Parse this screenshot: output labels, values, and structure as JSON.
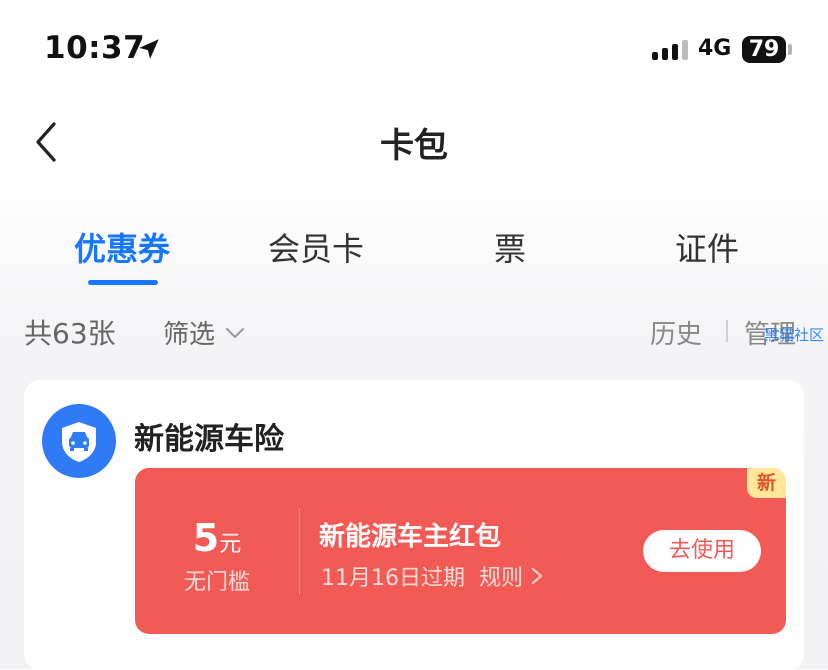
{
  "status": {
    "time": "10:37",
    "network": "4G",
    "battery": "79"
  },
  "nav": {
    "title": "卡包"
  },
  "tabs": [
    {
      "label": "优惠券",
      "active": true
    },
    {
      "label": "会员卡",
      "active": false
    },
    {
      "label": "票",
      "active": false
    },
    {
      "label": "证件",
      "active": false
    }
  ],
  "filter": {
    "count": "共63张",
    "filter_label": "筛选",
    "history": "历史",
    "manage": "管理",
    "watermark": "黑猫社区"
  },
  "card": {
    "brand": "新能源车险",
    "coupon": {
      "amount": "5",
      "unit": "元",
      "threshold": "无门槛",
      "title": "新能源车主红包",
      "expiry": "11月16日过期",
      "rules": "规则",
      "action": "去使用",
      "badge": "新"
    }
  },
  "colors": {
    "accent": "#1677ff",
    "coupon_red": "#f25a56",
    "badge_yellow": "#ffe89a"
  }
}
